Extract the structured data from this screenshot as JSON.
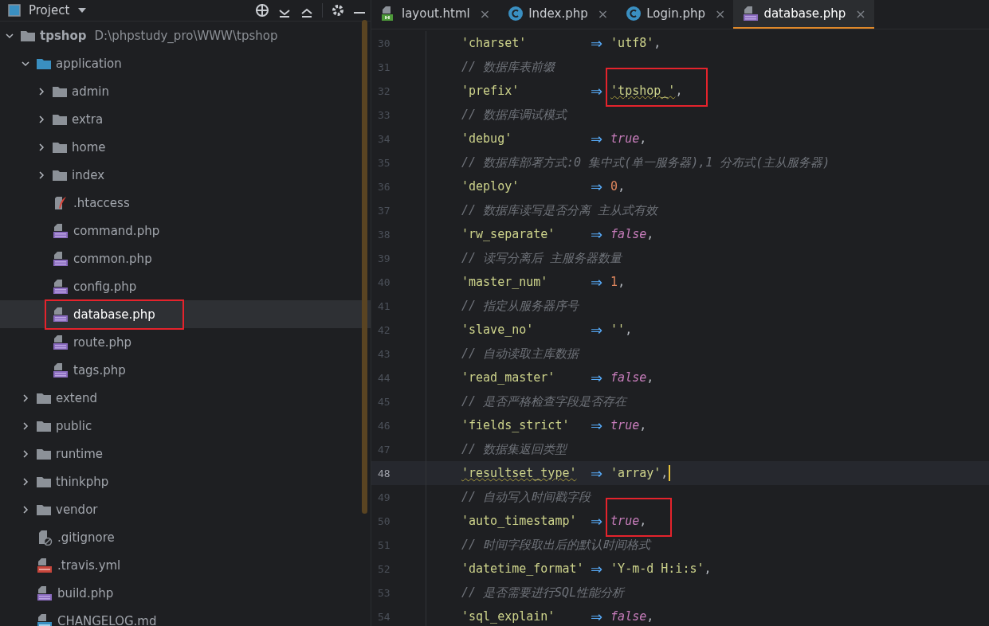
{
  "project_panel": {
    "title": "Project",
    "tree": [
      {
        "kind": "folder",
        "name": "tpshop",
        "path": "D:\\phpstudy_pro\\WWW\\tpshop",
        "expanded": true,
        "selected": false,
        "highlighted": false,
        "children": [
          {
            "kind": "source_folder",
            "name": "application",
            "expanded": true,
            "selected": false,
            "highlighted": false,
            "children": [
              {
                "kind": "folder",
                "name": "admin",
                "expanded": false,
                "selected": false,
                "highlighted": false
              },
              {
                "kind": "folder",
                "name": "extra",
                "expanded": false,
                "selected": false,
                "highlighted": false
              },
              {
                "kind": "folder",
                "name": "home",
                "expanded": false,
                "selected": false,
                "highlighted": false
              },
              {
                "kind": "folder",
                "name": "index",
                "expanded": false,
                "selected": false,
                "highlighted": false
              },
              {
                "kind": "htaccess",
                "name": ".htaccess",
                "selected": false,
                "highlighted": false
              },
              {
                "kind": "php",
                "name": "command.php",
                "selected": false,
                "highlighted": false
              },
              {
                "kind": "php",
                "name": "common.php",
                "selected": false,
                "highlighted": false
              },
              {
                "kind": "php",
                "name": "config.php",
                "selected": false,
                "highlighted": false
              },
              {
                "kind": "php",
                "name": "database.php",
                "selected": true,
                "highlighted": true
              },
              {
                "kind": "php",
                "name": "route.php",
                "selected": false,
                "highlighted": false
              },
              {
                "kind": "php",
                "name": "tags.php",
                "selected": false,
                "highlighted": false
              }
            ]
          },
          {
            "kind": "folder",
            "name": "extend",
            "expanded": false,
            "selected": false,
            "highlighted": false
          },
          {
            "kind": "folder",
            "name": "public",
            "expanded": false,
            "selected": false,
            "highlighted": false
          },
          {
            "kind": "folder",
            "name": "runtime",
            "expanded": false,
            "selected": false,
            "highlighted": false
          },
          {
            "kind": "folder",
            "name": "thinkphp",
            "expanded": false,
            "selected": false,
            "highlighted": false
          },
          {
            "kind": "folder",
            "name": "vendor",
            "expanded": false,
            "selected": false,
            "highlighted": false
          },
          {
            "kind": "gitignore",
            "name": ".gitignore",
            "selected": false,
            "highlighted": false
          },
          {
            "kind": "yml",
            "name": ".travis.yml",
            "selected": false,
            "highlighted": false
          },
          {
            "kind": "php",
            "name": "build.php",
            "selected": false,
            "highlighted": false
          },
          {
            "kind": "md",
            "name": "CHANGELOG.md",
            "selected": false,
            "highlighted": false
          }
        ]
      }
    ]
  },
  "editor": {
    "tabs": [
      {
        "kind": "html",
        "label": "layout.html",
        "close": "×",
        "selected": false
      },
      {
        "kind": "class",
        "label": "Index.php",
        "close": "×",
        "selected": false
      },
      {
        "kind": "class",
        "label": "Login.php",
        "close": "×",
        "selected": false
      },
      {
        "kind": "php",
        "label": "database.php",
        "close": "×",
        "selected": true
      }
    ],
    "lines": [
      {
        "number": "30",
        "kind": "entry",
        "key": "'charset'",
        "arrow": "⇒",
        "value": {
          "kind": "string",
          "text": "'utf8'"
        },
        "end": ",",
        "current": false,
        "highlighted": false,
        "key_typo": false,
        "value_typo": false
      },
      {
        "number": "31",
        "kind": "comment",
        "text": "// 数据库表前缀",
        "current": false
      },
      {
        "number": "32",
        "kind": "entry",
        "key": "'prefix'",
        "arrow": "⇒",
        "value": {
          "kind": "string",
          "text": "'tpshop_'"
        },
        "end": ",",
        "current": false,
        "highlighted": true,
        "key_typo": false,
        "value_typo": true
      },
      {
        "number": "33",
        "kind": "comment",
        "text": "// 数据库调试模式",
        "current": false
      },
      {
        "number": "34",
        "kind": "entry",
        "key": "'debug'",
        "arrow": "⇒",
        "value": {
          "kind": "keyword",
          "text": "true"
        },
        "end": ",",
        "current": false,
        "highlighted": false,
        "key_typo": false,
        "value_typo": false
      },
      {
        "number": "35",
        "kind": "comment",
        "text": "// 数据库部署方式:0 集中式(单一服务器),1 分布式(主从服务器)",
        "current": false
      },
      {
        "number": "36",
        "kind": "entry",
        "key": "'deploy'",
        "arrow": "⇒",
        "value": {
          "kind": "number",
          "text": "0"
        },
        "end": ",",
        "current": false,
        "highlighted": false,
        "key_typo": false,
        "value_typo": false
      },
      {
        "number": "37",
        "kind": "comment",
        "text": "// 数据库读写是否分离 主从式有效",
        "current": false
      },
      {
        "number": "38",
        "kind": "entry",
        "key": "'rw_separate'",
        "arrow": "⇒",
        "value": {
          "kind": "keyword",
          "text": "false"
        },
        "end": ",",
        "current": false,
        "highlighted": false,
        "key_typo": false,
        "value_typo": false
      },
      {
        "number": "39",
        "kind": "comment",
        "text": "// 读写分离后 主服务器数量",
        "current": false
      },
      {
        "number": "40",
        "kind": "entry",
        "key": "'master_num'",
        "arrow": "⇒",
        "value": {
          "kind": "number",
          "text": "1"
        },
        "end": ",",
        "current": false,
        "highlighted": false,
        "key_typo": false,
        "value_typo": false
      },
      {
        "number": "41",
        "kind": "comment",
        "text": "// 指定从服务器序号",
        "current": false
      },
      {
        "number": "42",
        "kind": "entry",
        "key": "'slave_no'",
        "arrow": "⇒",
        "value": {
          "kind": "string",
          "text": "''"
        },
        "end": ",",
        "current": false,
        "highlighted": false,
        "key_typo": false,
        "value_typo": false
      },
      {
        "number": "43",
        "kind": "comment",
        "text": "// 自动读取主库数据",
        "current": false
      },
      {
        "number": "44",
        "kind": "entry",
        "key": "'read_master'",
        "arrow": "⇒",
        "value": {
          "kind": "keyword",
          "text": "false"
        },
        "end": ",",
        "current": false,
        "highlighted": false,
        "key_typo": false,
        "value_typo": false
      },
      {
        "number": "45",
        "kind": "comment",
        "text": "// 是否严格检查字段是否存在",
        "current": false
      },
      {
        "number": "46",
        "kind": "entry",
        "key": "'fields_strict'",
        "arrow": "⇒",
        "value": {
          "kind": "keyword",
          "text": "true"
        },
        "end": ",",
        "current": false,
        "highlighted": false,
        "key_typo": false,
        "value_typo": false
      },
      {
        "number": "47",
        "kind": "comment",
        "text": "// 数据集返回类型",
        "current": false
      },
      {
        "number": "48",
        "kind": "entry",
        "key": "'resultset_type'",
        "arrow": "⇒",
        "value": {
          "kind": "string",
          "text": "'array'"
        },
        "end": ",",
        "current": true,
        "highlighted": false,
        "key_typo": true,
        "value_typo": false
      },
      {
        "number": "49",
        "kind": "comment",
        "text": "// 自动写入时间戳字段",
        "current": false
      },
      {
        "number": "50",
        "kind": "entry",
        "key": "'auto_timestamp'",
        "arrow": "⇒",
        "value": {
          "kind": "keyword",
          "text": "true"
        },
        "end": ",",
        "current": false,
        "highlighted": true,
        "key_typo": false,
        "value_typo": false
      },
      {
        "number": "51",
        "kind": "comment",
        "text": "// 时间字段取出后的默认时间格式",
        "current": false
      },
      {
        "number": "52",
        "kind": "entry",
        "key": "'datetime_format'",
        "arrow": "⇒",
        "value": {
          "kind": "string",
          "text": "'Y-m-d H:i:s'"
        },
        "end": ",",
        "current": false,
        "highlighted": false,
        "key_typo": false,
        "value_typo": false
      },
      {
        "number": "53",
        "kind": "comment",
        "text": "// 是否需要进行SQL性能分析",
        "current": false
      },
      {
        "number": "54",
        "kind": "entry",
        "key": "'sql_explain'",
        "arrow": "⇒",
        "value": {
          "kind": "keyword",
          "text": "false"
        },
        "end": ",",
        "current": false,
        "highlighted": false,
        "key_typo": false,
        "value_typo": false
      }
    ]
  }
}
